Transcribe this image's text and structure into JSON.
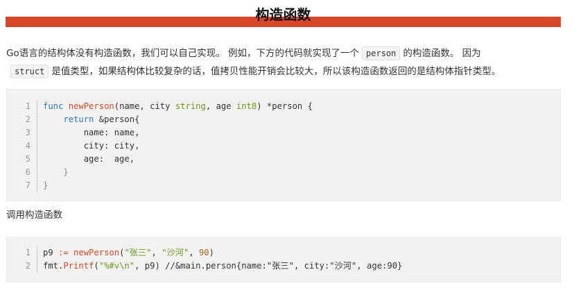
{
  "heading": "构造函数",
  "paragraph": {
    "part1": "Go语言的结构体没有构造函数，我们可以自己实现。 例如，下方的代码就实现了一个",
    "code1": "person",
    "part2": "的构造函数。 因为",
    "code2": "struct",
    "part3": "是值类型，如果结构体比较复杂的话，值拷贝性能开销会比较大，所以该构造函数返回的是结构体指针类型。"
  },
  "code_block_1": {
    "line_numbers": [
      "1",
      "2",
      "3",
      "4",
      "5",
      "6",
      "7"
    ],
    "l1": {
      "kw_func": "func",
      "name": "newPerson",
      "open": "(name, city ",
      "t1": "string",
      "mid": ", age ",
      "t2": "int8",
      "close": ") *person {"
    },
    "l2": {
      "indent": "    ",
      "kw": "return",
      "rest": " &person{"
    },
    "l3": "        name: name,",
    "l4": "        city: city,",
    "l5": "        age:  age,",
    "l6": "    }",
    "l7": "}"
  },
  "caption": "调用构造函数",
  "code_block_2": {
    "line_numbers": [
      "1",
      "2"
    ],
    "l1": {
      "var": "p9 ",
      "op": ":=",
      "sp": " ",
      "fn": "newPerson",
      "open": "(",
      "s1": "\"张三\"",
      "comma1": ", ",
      "s2": "\"沙河\"",
      "comma2": ", ",
      "num": "90",
      "close": ")"
    },
    "l2": {
      "pkg": "fmt.",
      "fn": "Printf",
      "open": "(",
      "s1": "\"%#v\\n\"",
      "rest": ", p9) ",
      "comment": "//&main.person{name:\"张三\", city:\"沙河\", age:90}"
    }
  },
  "colors": {
    "accent_bar": "#d9472b",
    "keyword": "#2a78c0",
    "function": "#d9472b",
    "type": "#6a9a1f",
    "code_bg": "#f4f2f0"
  }
}
